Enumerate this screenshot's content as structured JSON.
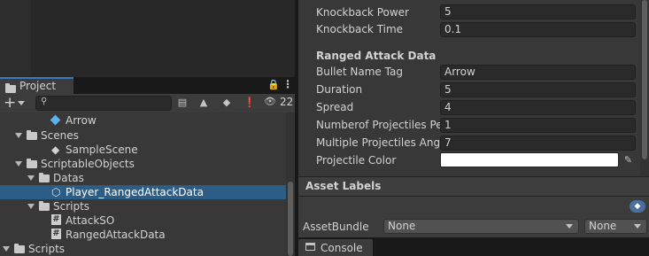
{
  "project": {
    "tab_label": "Project",
    "add_label": "+",
    "hidden_count": "22"
  },
  "tree": [
    {
      "label": "Arrow",
      "kind": "prefab"
    },
    {
      "label": "Scenes",
      "kind": "folder"
    },
    {
      "label": "SampleScene",
      "kind": "scene"
    },
    {
      "label": "ScriptableObjects",
      "kind": "folder"
    },
    {
      "label": "Datas",
      "kind": "folder"
    },
    {
      "label": "Player_RangedAttackData",
      "kind": "asset",
      "selected": true
    },
    {
      "label": "Scripts",
      "kind": "folder"
    },
    {
      "label": "AttackSO",
      "kind": "script"
    },
    {
      "label": "RangedAttackData",
      "kind": "script"
    },
    {
      "label": "Scripts",
      "kind": "folder"
    }
  ],
  "inspector": {
    "fields_top": [
      {
        "label": "Knockback Power",
        "value": "5"
      },
      {
        "label": "Knockback Time",
        "value": "0.1"
      }
    ],
    "section_title": "Ranged Attack Data",
    "fields": [
      {
        "label": "Bullet Name Tag",
        "value": "Arrow"
      },
      {
        "label": "Duration",
        "value": "5"
      },
      {
        "label": "Spread",
        "value": "4"
      },
      {
        "label": "Numberof Projectiles Per",
        "value": "1"
      },
      {
        "label": "Multiple Projectiles Ange",
        "value": "7"
      }
    ],
    "color_label": "Projectile Color",
    "color_value": "#ffffff"
  },
  "asset_labels": {
    "title": "Asset Labels",
    "assetbundle_label": "AssetBundle",
    "bundle_value": "None",
    "variant_value": "None"
  },
  "console": {
    "tab_label": "Console"
  },
  "colors": {
    "selection": "#2c5d87",
    "accent": "#3a79bb"
  }
}
